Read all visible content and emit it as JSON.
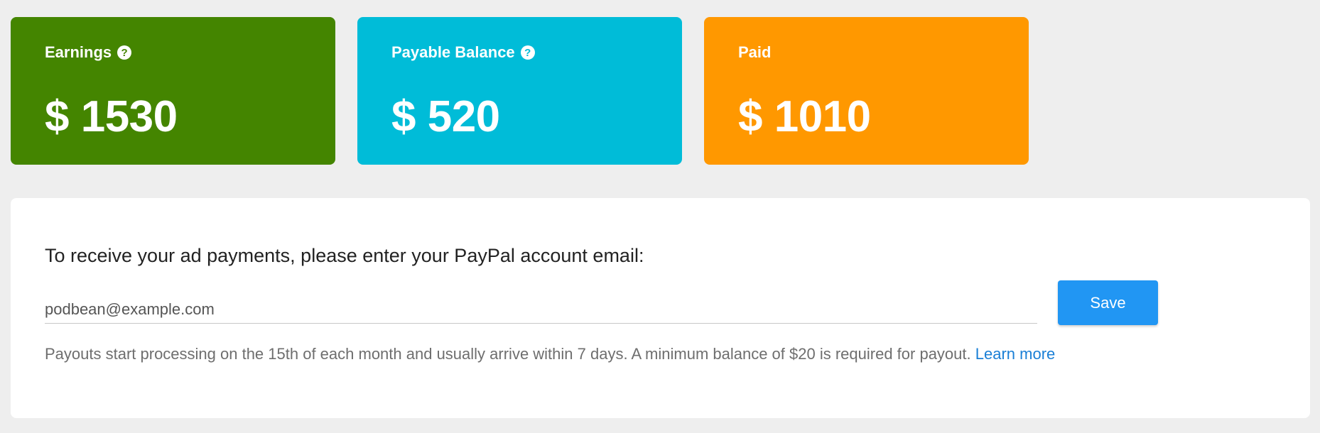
{
  "colors": {
    "earnings": "#448500",
    "payable": "#00bcd8",
    "paid": "#ff9800",
    "save_button": "#2196f3",
    "link": "#1a7fd6"
  },
  "cards": [
    {
      "title": "Earnings",
      "value": "$ 1530",
      "help_icon": "help-circle-icon",
      "help_glyph": "?"
    },
    {
      "title": "Payable Balance",
      "value": "$ 520",
      "help_icon": "help-circle-icon",
      "help_glyph": "?"
    },
    {
      "title": "Paid",
      "value": "$ 1010"
    }
  ],
  "payout": {
    "prompt": "To receive your ad payments, please enter your PayPal account email:",
    "email_value": "podbean@example.com",
    "save_label": "Save",
    "note": "Payouts start processing on the 15th of each month and usually arrive within 7 days. A minimum balance of $20 is required for payout.",
    "learn_more": "Learn more"
  }
}
